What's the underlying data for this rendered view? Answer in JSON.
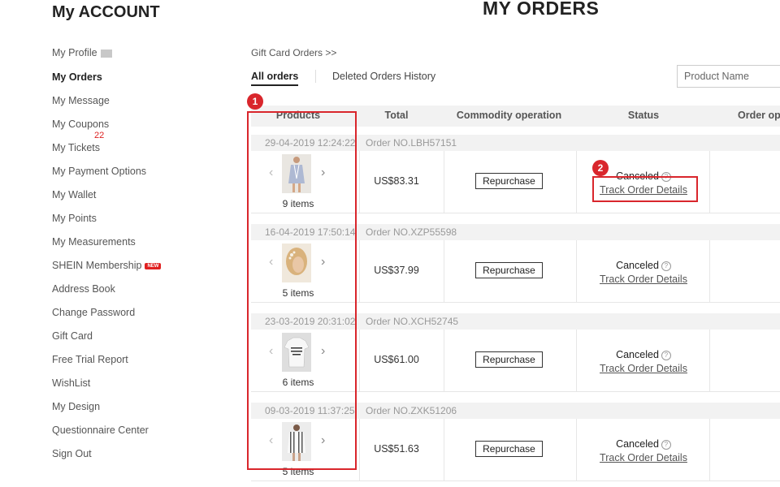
{
  "account_title": "My ACCOUNT",
  "page_title": "MY ORDERS",
  "sidebar": {
    "items": [
      {
        "label": "My Profile"
      },
      {
        "label": "My Orders",
        "active": true
      },
      {
        "label": "My Message"
      },
      {
        "label": "My Coupons"
      },
      {
        "label": "My Tickets",
        "badge": "22"
      },
      {
        "label": "My Payment Options"
      },
      {
        "label": "My Wallet"
      },
      {
        "label": "My Points"
      },
      {
        "label": "My Measurements"
      },
      {
        "label": "SHEIN Membership",
        "tag": "NEW"
      },
      {
        "label": "Address Book"
      },
      {
        "label": "Change Password"
      },
      {
        "label": "Gift Card"
      },
      {
        "label": "Free Trial Report"
      },
      {
        "label": "WishList"
      },
      {
        "label": "My Design"
      },
      {
        "label": "Questionnaire Center"
      },
      {
        "label": "Sign Out"
      }
    ]
  },
  "breadcrumb": "Gift Card Orders >>",
  "tabs": [
    {
      "label": "All orders",
      "active": true
    },
    {
      "label": "Deleted Orders History"
    }
  ],
  "search": {
    "placeholder": "Product Name"
  },
  "table": {
    "headers": [
      "Products",
      "Total",
      "Commodity operation",
      "Status",
      "Order op"
    ]
  },
  "orders": [
    {
      "date": "29-04-2019 12:24:22",
      "order_no": "Order NO.LBH57151",
      "items": "9 items",
      "total": "US$83.31",
      "action": "Repurchase",
      "status": "Canceled",
      "track": "Track Order Details",
      "thumb": "dress"
    },
    {
      "date": "16-04-2019 17:50:14",
      "order_no": "Order NO.XZP55598",
      "items": "5 items",
      "total": "US$37.99",
      "action": "Repurchase",
      "status": "Canceled",
      "track": "Track Order Details",
      "thumb": "hair"
    },
    {
      "date": "23-03-2019 20:31:02",
      "order_no": "Order NO.XCH52745",
      "items": "6 items",
      "total": "US$61.00",
      "action": "Repurchase",
      "status": "Canceled",
      "track": "Track Order Details",
      "thumb": "tshirt"
    },
    {
      "date": "09-03-2019 11:37:25",
      "order_no": "Order NO.ZXK51206",
      "items": "5 items",
      "total": "US$51.63",
      "action": "Repurchase",
      "status": "Canceled",
      "track": "Track Order Details",
      "thumb": "stripe"
    }
  ],
  "annotations": [
    {
      "number": "1"
    },
    {
      "number": "2"
    }
  ],
  "colors": {
    "annotation": "#d9262c",
    "badge": "#e02020"
  }
}
